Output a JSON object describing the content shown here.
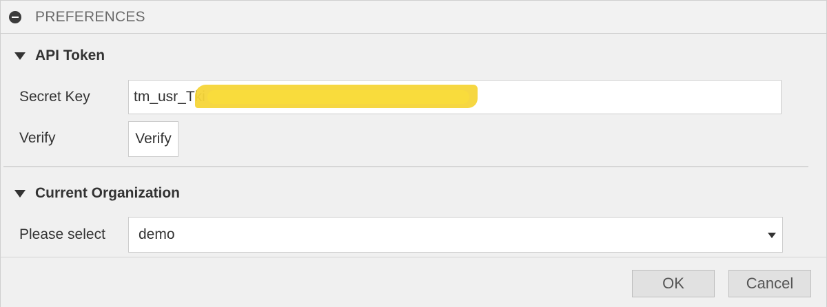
{
  "window": {
    "title": "PREFERENCES",
    "collapse_icon": "minus-circle-icon"
  },
  "sections": {
    "api_token": {
      "header": "API Token",
      "secret_key_label": "Secret Key",
      "secret_key_value": "tm_usr_Tki",
      "verify_label": "Verify",
      "verify_button": "Verify"
    },
    "organization": {
      "header": "Current Organization",
      "select_label": "Please select",
      "selected_value": "demo"
    }
  },
  "footer": {
    "ok_label": "OK",
    "cancel_label": "Cancel"
  },
  "colors": {
    "background": "#f0f0f0",
    "redaction": "#f6d538",
    "text": "#333333"
  }
}
